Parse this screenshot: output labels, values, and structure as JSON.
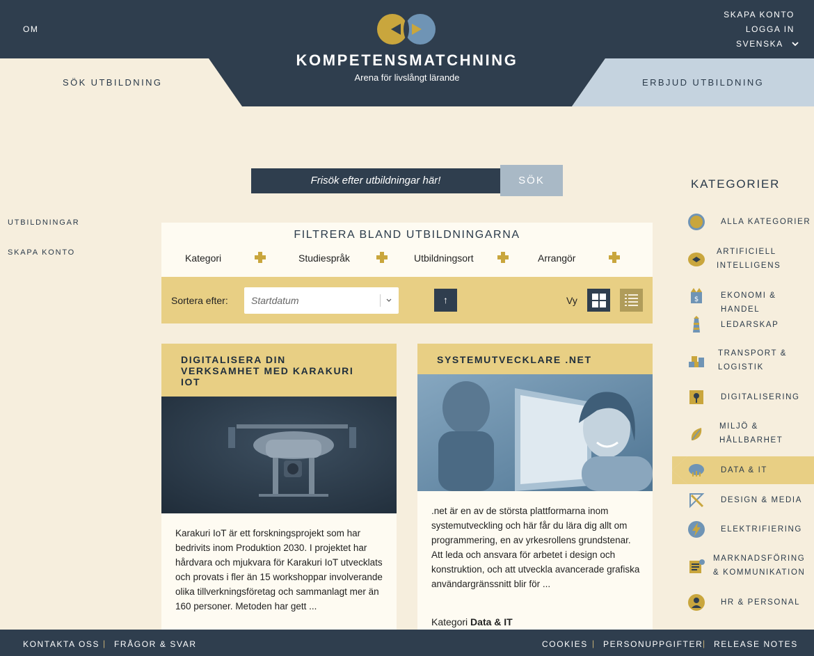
{
  "header": {
    "om": "OM",
    "skapa_konto": "SKAPA KONTO",
    "logga_in": "LOGGA IN",
    "language": "SVENSKA",
    "brand_title": "KOMPETENSMATCHNING",
    "brand_subtitle": "Arena för livslångt lärande",
    "tab_left": "SÖK UTBILDNING",
    "tab_right": "ERBJUD UTBILDNING"
  },
  "search": {
    "placeholder": "Frisök efter utbildningar här!",
    "button": "SÖK"
  },
  "left_nav": {
    "items": [
      "UTBILDNINGAR",
      "SKAPA KONTO"
    ]
  },
  "filter": {
    "title": "FILTRERA BLAND UTBILDNINGARNA",
    "items": [
      "Kategori",
      "Studiespråk",
      "Utbildningsort",
      "Arrangör"
    ]
  },
  "sort": {
    "label": "Sortera efter:",
    "selected": "Startdatum",
    "direction_icon": "↑",
    "view_label": "Vy"
  },
  "cards": [
    {
      "title": "DIGITALISERA DIN VERKSAMHET MED KARAKURI IOT",
      "description": "Karakuri IoT är ett forskningsprojekt som har bedrivits inom Produktion 2030. I projektet har hårdvara och mjukvara för Karakuri IoT utvecklats och provats i fler än 15 workshoppar involverande olika tillverkningsföretag och sammanlagt mer än 160 personer. Metoden har gett ..."
    },
    {
      "title": "SYSTEMUTVECKLARE .NET",
      "description": ".net är en av de största plattformarna inom systemutveckling och här får du lära dig allt om programmering, en av yrkesrollens grundstenar. Att leda och ansvara för arbetet i design och konstruktion, och att utveckla avancerade grafiska användargränssnitt blir för ...",
      "meta_label": "Kategori",
      "meta_value": "Data & IT"
    }
  ],
  "categories": {
    "title": "KATEGORIER",
    "items": [
      {
        "label": "ALLA KATEGORIER",
        "icon": "all-categories-icon"
      },
      {
        "label": "ARTIFICIELL INTELLIGENS",
        "icon": "ai-brain-icon"
      },
      {
        "label": "EKONOMI & HANDEL",
        "icon": "economy-icon"
      },
      {
        "label": "LEDARSKAP",
        "icon": "lighthouse-icon"
      },
      {
        "label": "TRANSPORT & LOGISTIK",
        "icon": "boxes-icon"
      },
      {
        "label": "DIGITALISERING",
        "icon": "digital-icon"
      },
      {
        "label": "MILJÖ & HÅLLBARHET",
        "icon": "leaf-icon"
      },
      {
        "label": "DATA & IT",
        "icon": "cloud-icon"
      },
      {
        "label": "DESIGN & MEDIA",
        "icon": "design-icon"
      },
      {
        "label": "ELEKTRIFIERING",
        "icon": "lightning-icon"
      },
      {
        "label": "MARKNADSFÖRING & KOMMUNIKATION",
        "icon": "marketing-icon"
      },
      {
        "label": "HR & PERSONAL",
        "icon": "hr-icon"
      }
    ],
    "active": "DATA & IT"
  },
  "footer": {
    "left": [
      "KONTAKTA OSS",
      "FRÅGOR & SVAR"
    ],
    "right": [
      "COOKIES",
      "PERSONUPPGIFTER",
      "RELEASE NOTES"
    ],
    "separator": "|"
  },
  "colors": {
    "navy": "#2f3e4e",
    "cream": "#f6eedd",
    "gold": "#e8cf84",
    "accent_gold": "#c9a63d",
    "light_blue": "#c5d3df"
  }
}
